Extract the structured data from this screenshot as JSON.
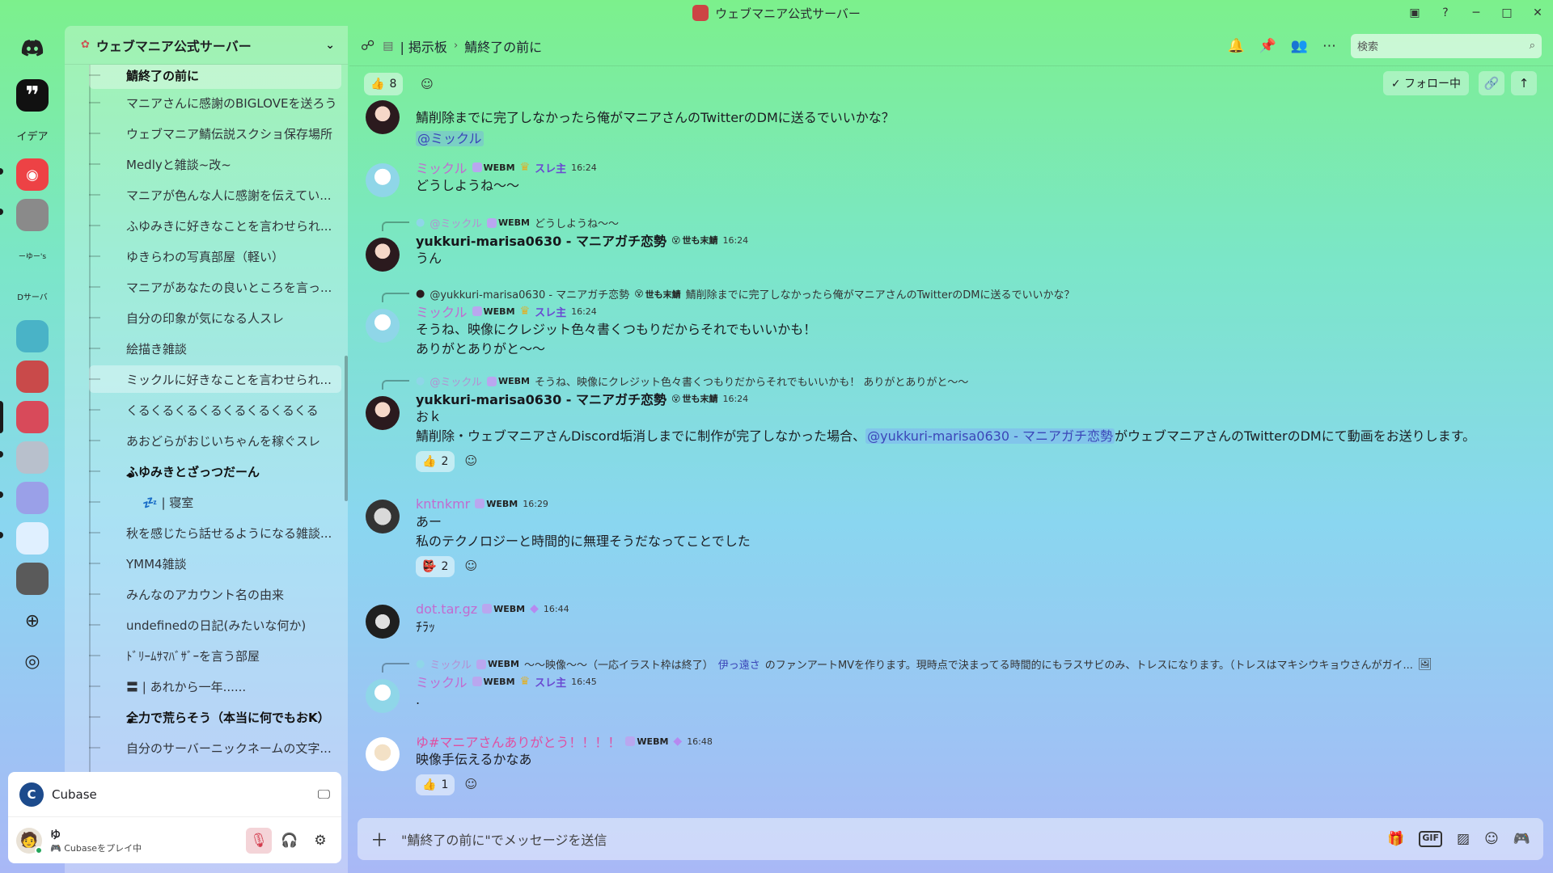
{
  "window": {
    "title": "ウェブマニア公式サーバー",
    "controls": [
      "─",
      "□",
      "✕"
    ]
  },
  "rail": {
    "labels": [
      "イデア",
      "ーゆー's",
      "Dサーバ"
    ]
  },
  "sidebar": {
    "server_name": "ウェブマニア公式サーバー",
    "threads": [
      {
        "label": "鯖終了の前に",
        "unread": true,
        "selected": true
      },
      {
        "label": "マニアさんに感謝のBIGLOVEを送ろう"
      },
      {
        "label": "ウェブマニア鯖伝説スクショ保存場所"
      },
      {
        "label": "Medlyと雑談~改~"
      },
      {
        "label": "マニアが色んな人に感謝を伝えてい..."
      },
      {
        "label": "ふゆみきに好きなことを言わせられ..."
      },
      {
        "label": "ゆきらわの写真部屋（軽い）"
      },
      {
        "label": "マニアがあなたの良いところを言っ..."
      },
      {
        "label": "自分の印象が気になる人スレ"
      },
      {
        "label": "絵描き雑談"
      },
      {
        "label": "ミックルに好きなことを言わせられ...",
        "selected": true
      },
      {
        "label": "くるくるくるくるくるくるくるくる"
      },
      {
        "label": "あおどらがおじいちゃんを稼ぐスレ"
      },
      {
        "label": "ふゆみきとざっつだーん",
        "unread": true,
        "dot": true
      },
      {
        "label": "💤 | 寝室"
      },
      {
        "label": "秋を感じたら話せるようになる雑談..."
      },
      {
        "label": "YMM4雑談"
      },
      {
        "label": "みんなのアカウント名の由来"
      },
      {
        "label": "undefinedの日記(みたいな何か)"
      },
      {
        "label": "ﾄﾞﾘｰﾑｻﾏﾊﾞｻﾞｰを言う部屋"
      },
      {
        "label": "〓 | あれから一年......"
      },
      {
        "label": "全力で荒らそう（本当に何でもおK）",
        "unread": true,
        "dot": true
      },
      {
        "label": "自分のサーバーニックネームの文字..."
      }
    ]
  },
  "activity": {
    "app": "Cubase"
  },
  "user": {
    "name": "ゆ",
    "status": "Cubaseをプレイ中"
  },
  "topbar": {
    "forum": "| 掲示板",
    "sep": "›",
    "thread": "鯖終了の前に",
    "search_placeholder": "検索"
  },
  "subbar": {
    "reaction_emoji": "👍",
    "reaction_count": "8",
    "follow_label": "✓ フォロー中"
  },
  "messages": [
    {
      "text": "鯖削除までに完了しなかったら俺がマニアさんのTwitterのDMに送るでいいかな？",
      "mention": "@ミックル"
    },
    {
      "name": "ミックル",
      "tag": "WEBM",
      "role": "スレ主",
      "time": "16:24",
      "text": "どうしようね～～"
    },
    {
      "reply_name": "@ミックル",
      "reply_tag": "WEBM",
      "reply_text": "どうしようね～～",
      "name": "yukkuri-marisa0630 - マニアガチ恋勢",
      "tag": "世も末鯖",
      "time": "16:24",
      "text": "うん"
    },
    {
      "reply_name": "@yukkuri-marisa0630 - マニアガチ恋勢",
      "reply_tag": "世も末鯖",
      "reply_text": "鯖削除までに完了しなかったら俺がマニアさんのTwitterのDMに送るでいいかな？",
      "name": "ミックル",
      "tag": "WEBM",
      "role": "スレ主",
      "time": "16:24",
      "line1": "そうね、映像にクレジット色々書くつもりだからそれでもいいかも！",
      "line2": "ありがとありがと～～"
    },
    {
      "reply_name": "@ミックル",
      "reply_tag": "WEBM",
      "reply_text": "そうね、映像にクレジット色々書くつもりだからそれでもいいかも！ ありがとありがと～～",
      "name": "yukkuri-marisa0630 - マニアガチ恋勢",
      "tag": "世も末鯖",
      "time": "16:24",
      "line1": "おｋ",
      "line2_pre": "鯖削除・ウェブマニアさんDiscord垢消しまでに制作が完了しなかった場合、",
      "line2_mention": "@yukkuri-marisa0630 - マニアガチ恋勢",
      "line2_post": "がウェブマニアさんのTwitterのDMにて動画をお送りします。",
      "reaction_emoji": "👍",
      "reaction_count": "2"
    },
    {
      "name": "kntnkmr",
      "tag": "WEBM",
      "time": "16:29",
      "line1": "あー",
      "line2": "私のテクノロジーと時間的に無理そうだなってことでした",
      "reaction_emoji": "👺",
      "reaction_count": "2"
    },
    {
      "name": "dot.tar.gz",
      "tag": "WEBM",
      "time": "16:44",
      "text": "ﾁﾗｯ"
    },
    {
      "reply_name": "ミックル",
      "reply_tag": "WEBM",
      "reply_text": "～～映像～～（一応イラスト枠は終了）",
      "reply_link": "伊っ遠さ",
      "reply_text2": "のファンアートMVを作ります。現時点で決まってる時間的にもラスサビのみ、トレスになります。（トレスはマキシウキョウさんがガイ...",
      "name": "ミックル",
      "tag": "WEBM",
      "role": "スレ主",
      "time": "16:45",
      "text": "."
    },
    {
      "name": "ゆ#マニアさんありがとう！！！！",
      "tag": "WEBM",
      "time": "16:48",
      "text": "映像手伝えるかなあ",
      "reaction_emoji": "👍",
      "reaction_count": "1"
    }
  ],
  "composer": {
    "placeholder": "\"鯖終了の前に\"でメッセージを送信"
  },
  "icons": [
    "discord-icon",
    "bell-icon",
    "pin-icon",
    "members-icon",
    "more-icon",
    "search-icon",
    "gift-icon",
    "gif-icon",
    "sticker-icon",
    "emoji-icon",
    "game-icon"
  ],
  "colors": {
    "accent": "#6a4ad1",
    "mention": "#3b46b8",
    "muted": "#d23a4b"
  }
}
